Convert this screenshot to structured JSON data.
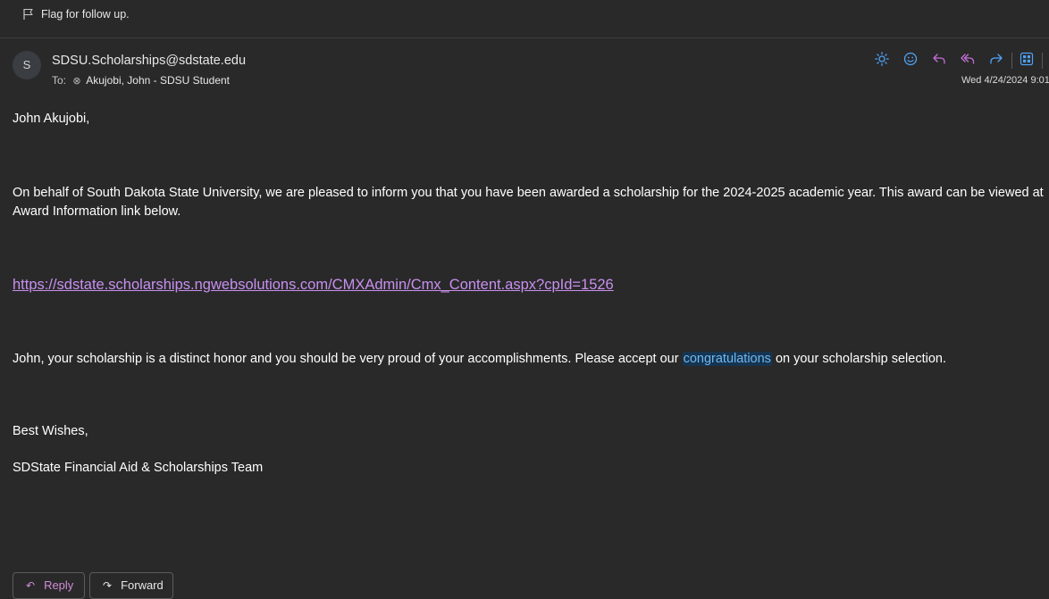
{
  "flag": {
    "text": "Flag for follow up."
  },
  "header": {
    "avatar_initial": "S",
    "sender": "SDSU.Scholarships@sdstate.edu",
    "to_label": "To:",
    "recipient": "Akujobi, John - SDSU Student",
    "timestamp": "Wed 4/24/2024 9:01"
  },
  "actions": [
    "sun-icon",
    "smiley-icon",
    "reply-icon",
    "reply-all-icon",
    "forward-icon",
    "apps-icon"
  ],
  "body": {
    "greeting": "John Akujobi,",
    "para1_line1": "On behalf of South Dakota State University, we are pleased to inform you that you have been awarded a scholarship for the 2024-2025 academic year.  This award can be viewed at",
    "para1_line2": "Award Information link below.",
    "link": "https://sdstate.scholarships.ngwebsolutions.com/CMXAdmin/Cmx_Content.aspx?cpId=1526",
    "para2_before": "John, your scholarship is a distinct honor and you should be very proud of your accomplishments.  Please accept our ",
    "para2_highlight": "congratulations",
    "para2_after": " on your scholarship selection.",
    "sign_off": "Best Wishes,",
    "signature": "SDState Financial Aid & Scholarships Team"
  },
  "footer": {
    "reply_label": "Reply",
    "forward_label": "Forward"
  },
  "colors": {
    "background": "#292929",
    "accent_blue": "#4fa3f7",
    "accent_purple": "#c890f0",
    "highlight_bg": "#163450"
  }
}
